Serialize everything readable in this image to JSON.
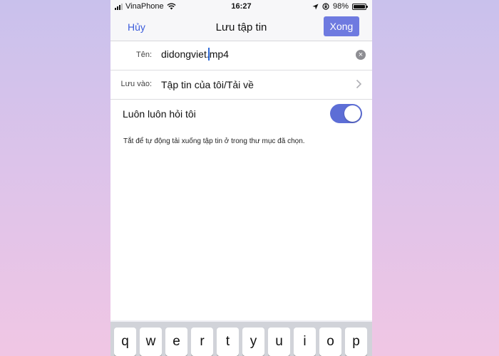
{
  "status_bar": {
    "carrier": "VinaPhone",
    "time": "16:27",
    "battery": "98%",
    "battery_level": 0.98,
    "icons": [
      "signal-icon",
      "wifi-icon",
      "location-icon",
      "rotation-lock-icon",
      "battery-icon"
    ]
  },
  "nav": {
    "cancel_label": "Hủy",
    "title": "Lưu tập tin",
    "done_label": "Xong"
  },
  "form": {
    "name_label": "Tên:",
    "name_value": "didongviet.mp4",
    "location_label": "Lưu vào:",
    "location_value": "Tập tin của tôi/Tải về",
    "always_ask_label": "Luôn luôn hỏi tôi",
    "always_ask_on": true,
    "note": "Tắt để tự động tải xuống tập tin ở trong thư mục đã chọn."
  },
  "keyboard": {
    "keys": [
      "q",
      "w",
      "e",
      "r",
      "t",
      "y",
      "u",
      "i",
      "o",
      "p"
    ]
  },
  "colors": {
    "accent": "#6e7ae0",
    "toggle_on": "#5d6ed6",
    "link": "#3b5bdb"
  }
}
